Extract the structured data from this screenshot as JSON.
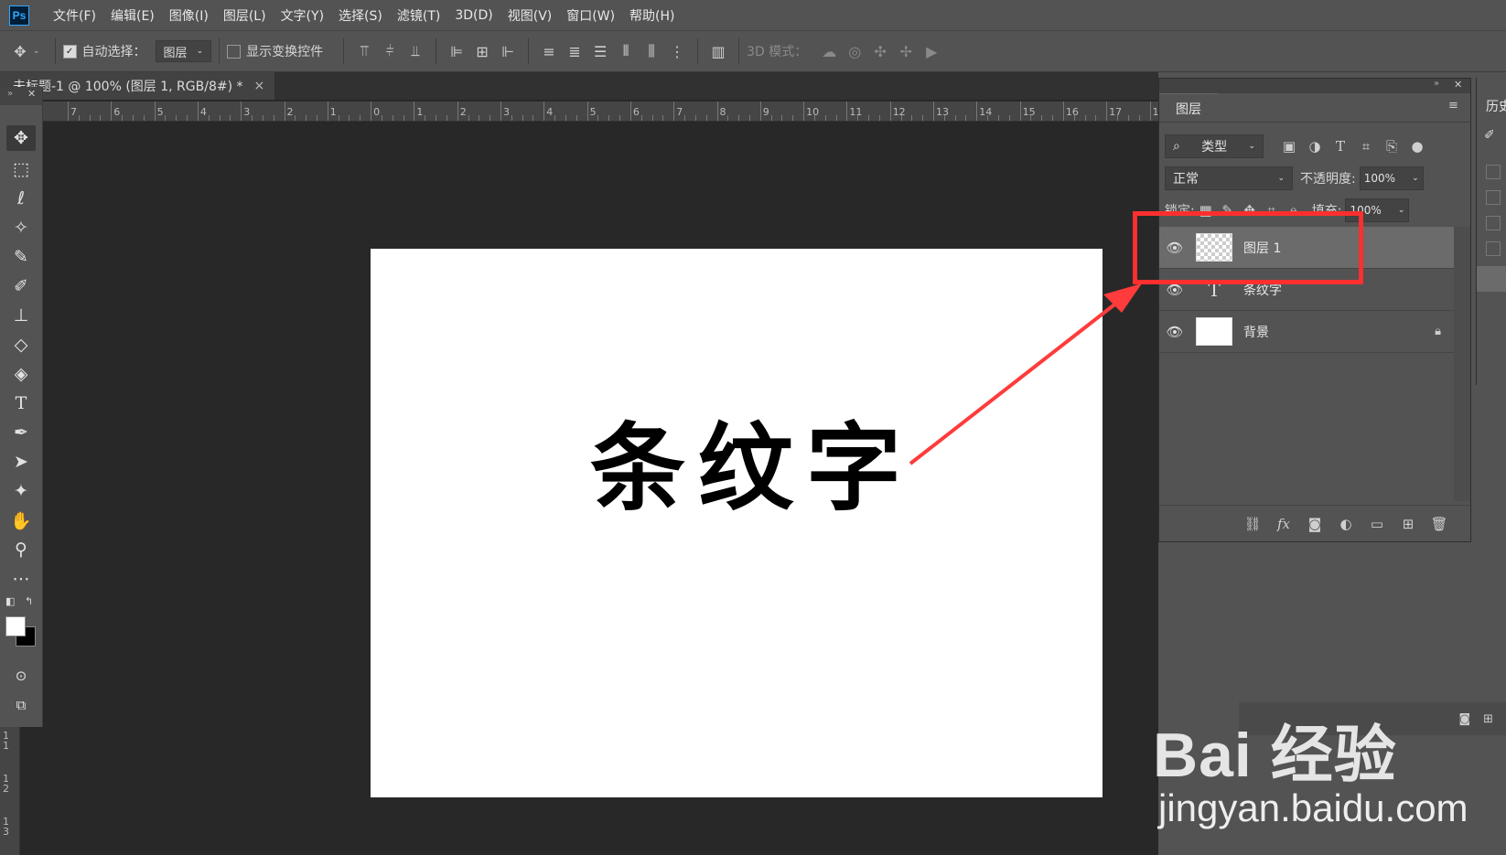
{
  "app": {
    "logo": "Ps"
  },
  "menu": [
    "文件(F)",
    "编辑(E)",
    "图像(I)",
    "图层(L)",
    "文字(Y)",
    "选择(S)",
    "滤镜(T)",
    "3D(D)",
    "视图(V)",
    "窗口(W)",
    "帮助(H)"
  ],
  "options": {
    "auto_select_label": "自动选择：",
    "auto_select_checked": true,
    "auto_select_target": "图层",
    "show_transform_label": "显示变换控件",
    "show_transform_checked": false,
    "mode_3d_label": "3D 模式："
  },
  "document": {
    "tab_title": "未标题-1 @ 100% (图层 1, RGB/8#) *",
    "close_glyph": "×",
    "canvas_text": "条纹字"
  },
  "ruler": {
    "horizontal": [
      "7",
      "6",
      "5",
      "4",
      "3",
      "2",
      "1",
      "0",
      "1",
      "2",
      "3",
      "4",
      "5",
      "6",
      "7",
      "8",
      "9",
      "10",
      "11",
      "12",
      "13",
      "14",
      "15",
      "16",
      "17",
      "1"
    ],
    "vertical": [
      "1\n1",
      "1\n2",
      "1\n3"
    ]
  },
  "layers_panel": {
    "tab": "图层",
    "filter_type": "类型",
    "blend_mode": "正常",
    "opacity_label": "不透明度:",
    "opacity_value": "100%",
    "lock_label": "锁定:",
    "fill_label": "填充:",
    "fill_value": "100%",
    "layers": [
      {
        "name": "图层 1",
        "type": "pixel",
        "visible": true,
        "selected": true
      },
      {
        "name": "条纹字",
        "type": "text",
        "visible": true,
        "selected": false
      },
      {
        "name": "背景",
        "type": "background",
        "visible": true,
        "selected": false,
        "locked": true
      }
    ]
  },
  "history_panel": {
    "tab": "历史"
  },
  "annotation": {
    "box_color": "#ff2f2f",
    "arrow_color": "#ff3b3b"
  },
  "watermark": {
    "brand": "Bai 经验",
    "url": "jingyan.baidu.com"
  },
  "colors": {
    "foreground": "#ffffff",
    "background": "#000000",
    "accent": "#31a8ff"
  }
}
